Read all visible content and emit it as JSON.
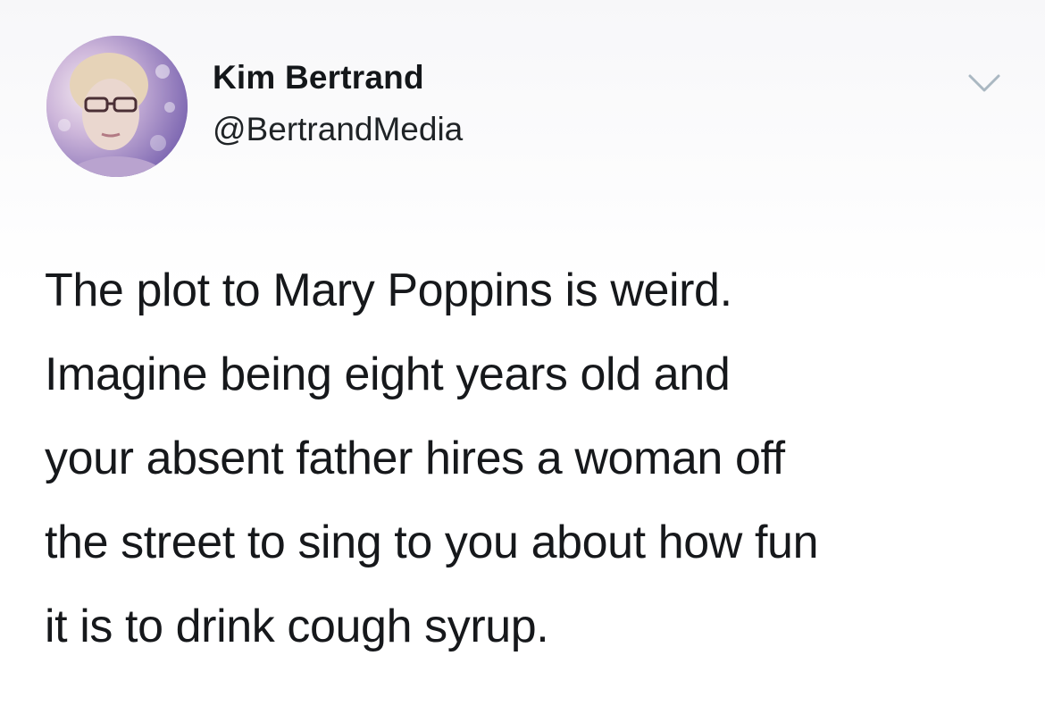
{
  "author": {
    "name": "Kim Bertrand",
    "handle": "@BertrandMedia"
  },
  "icons": {
    "avatar": "profile-photo",
    "menu": "chevron-down-icon"
  },
  "tweet": {
    "lines": [
      "The plot to Mary Poppins is weird.",
      "Imagine being eight years old and",
      "your absent father hires a woman off",
      "the street to sing to you about how fun",
      "it is to drink cough syrup."
    ]
  },
  "colors": {
    "text": "#14171a",
    "caret": "#aab8c2",
    "avatar_tint": "#9c86c4"
  }
}
